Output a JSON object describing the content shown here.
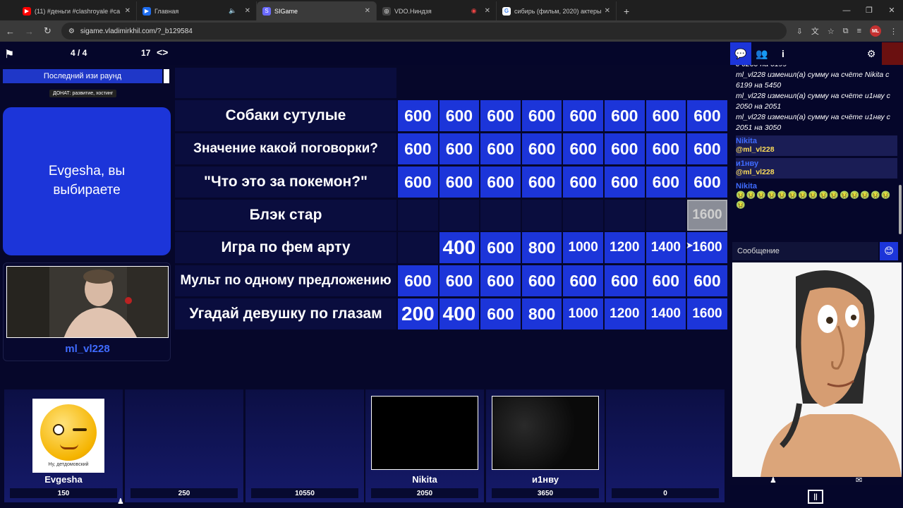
{
  "browser": {
    "tabs": [
      {
        "title": "(11) #деньги #clashroyale #ca",
        "icon_color": "#ff0000",
        "icon": "youtube-icon"
      },
      {
        "title": "Главная",
        "icon_color": "#1e6df0",
        "icon": "play-icon"
      },
      {
        "title": "SIGame",
        "icon_color": "#6a6aff",
        "icon": "sigame-icon"
      },
      {
        "title": "VDO.Ниндзя",
        "icon_color": "#444444",
        "icon": "vdo-icon"
      },
      {
        "title": "сибирь (фильм, 2020) актеры",
        "icon_color": "#4285f4",
        "icon": "google-icon"
      }
    ],
    "url": "sigame.vladimirkhil.com/?_b129584",
    "profile_initials": "ML"
  },
  "topbar": {
    "round_counter": "4 / 4",
    "number": "17"
  },
  "left": {
    "round_name": "Последний изи раунд",
    "donate_label": "ДОНАТ: развитие, хостинг",
    "showman_message": "Evgesha, вы выбираете",
    "showman_name": "ml_vl228"
  },
  "board": {
    "rows": [
      {
        "theme": "Собаки сутулые",
        "cells": [
          "600",
          "600",
          "600",
          "600",
          "600",
          "600",
          "600",
          "600"
        ]
      },
      {
        "theme": "Значение какой поговорки?",
        "cells": [
          "600",
          "600",
          "600",
          "600",
          "600",
          "600",
          "600",
          "600"
        ]
      },
      {
        "theme": "\"Что это за покемон?\"",
        "cells": [
          "600",
          "600",
          "600",
          "600",
          "600",
          "600",
          "600",
          "600"
        ]
      },
      {
        "theme": "Блэк стар",
        "cells": [
          "",
          "",
          "",
          "",
          "",
          "",
          "",
          "1600"
        ]
      },
      {
        "theme": "Игра по фем арту",
        "cells": [
          "",
          "400",
          "600",
          "800",
          "1000",
          "1200",
          "1400",
          "1600"
        ]
      },
      {
        "theme": "Мульт по одному предложению",
        "cells": [
          "600",
          "600",
          "600",
          "600",
          "600",
          "600",
          "600",
          "600"
        ]
      },
      {
        "theme": "Угадай девушку по глазам",
        "cells": [
          "200",
          "400",
          "600",
          "800",
          "1000",
          "1200",
          "1400",
          "1600"
        ]
      }
    ]
  },
  "players": [
    {
      "name": "Evgesha",
      "score": "150",
      "avatar_caption": "Ну, детдомовский"
    },
    {
      "name": "",
      "score": "250"
    },
    {
      "name": "",
      "score": "10550"
    },
    {
      "name": "Nikita",
      "score": "2050"
    },
    {
      "name": "и1нву",
      "score": "3650"
    },
    {
      "name": "",
      "score": "0"
    }
  ],
  "chat": {
    "system_lines": [
      "с 6200 на 6199",
      "ml_vl228 изменил(а) сумму на счёте Nikita с 6199 на 5450",
      "ml_vl228 изменил(а) сумму на счёте и1нву с 2050 на 2051",
      "ml_vl228 изменил(а) сумму на счёте и1нву с 2051 на 3050"
    ],
    "messages": [
      {
        "who": "Nikita",
        "text": "@ml_vl228"
      },
      {
        "who": "и1нву",
        "text": "@ml_vl228"
      },
      {
        "who": "Nikita",
        "text": "🤢🤢🤢🤢🤢🤢🤢🤢🤢🤢🤢🤢🤢🤢🤢🤢"
      }
    ],
    "input_placeholder": "Сообщение"
  },
  "colors": {
    "accent": "#1c35d9",
    "background": "#06072a",
    "name_blue": "#3f6bff",
    "mention_yellow": "#ffde59"
  }
}
